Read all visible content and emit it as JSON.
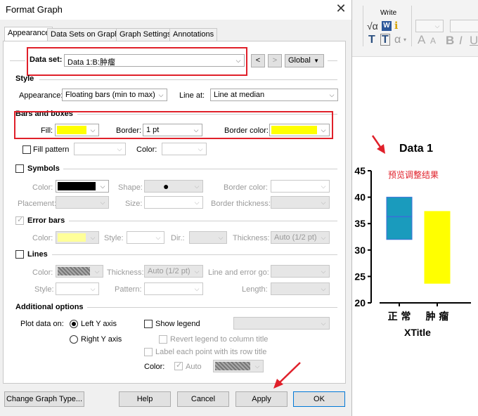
{
  "dialog": {
    "title": "Format Graph",
    "close_glyph": "✕",
    "tabs": [
      "Appearance",
      "Data Sets on Graph",
      "Graph Settings",
      "Annotations"
    ],
    "data_set": {
      "label": "Data set:",
      "value": "Data 1:B:肿瘤",
      "prev": "<",
      "next": ">",
      "scope": "Global"
    },
    "style": {
      "heading": "Style",
      "appearance_label": "Appearance:",
      "appearance_value": "Floating bars (min to max)",
      "line_at_label": "Line at:",
      "line_at_value": "Line at median"
    },
    "bars": {
      "heading": "Bars and boxes",
      "fill_label": "Fill:",
      "fill_color": "#ffff00",
      "border_label": "Border:",
      "border_value": "1 pt",
      "border_color_label": "Border color:",
      "border_color": "#ffff00",
      "fill_pattern_label": "Fill pattern",
      "color_label": "Color:"
    },
    "symbols": {
      "heading": "Symbols",
      "color_label": "Color:",
      "color_value": "#000000",
      "shape_label": "Shape:",
      "shape_glyph": "●",
      "border_color_label": "Border color:",
      "placement_label": "Placement:",
      "size_label": "Size:",
      "border_thickness_label": "Border thickness:"
    },
    "error_bars": {
      "heading": "Error bars",
      "color_label": "Color:",
      "color_value": "#ffff99",
      "style_label": "Style:",
      "dir_label": "Dir.:",
      "thickness_label": "Thickness:",
      "thickness_value": "Auto (1/2 pt)"
    },
    "lines": {
      "heading": "Lines",
      "color_label": "Color:",
      "thickness_label": "Thickness:",
      "thickness_value": "Auto (1/2 pt)",
      "line_error_label": "Line and error go:",
      "style_label": "Style:",
      "pattern_label": "Pattern:",
      "length_label": "Length:"
    },
    "additional": {
      "heading": "Additional options",
      "plot_on_label": "Plot data on:",
      "left_axis": "Left Y axis",
      "right_axis": "Right  Y axis",
      "show_legend": "Show legend",
      "revert_legend": "Revert legend to column title",
      "label_each_point": "Label each point with its row title",
      "color_label": "Color:",
      "auto_label": "Auto"
    },
    "buttons": {
      "change_type": "Change Graph Type...",
      "help": "Help",
      "cancel": "Cancel",
      "apply": "Apply",
      "ok": "OK"
    }
  },
  "ribbon": {
    "group_label": "Write",
    "glyph_sqrt": "√α",
    "glyph_w": "W",
    "glyph_info": "ℹ",
    "glyph_t1": "T",
    "glyph_t2": "T",
    "glyph_alpha": "α",
    "glyph_a1": "A",
    "glyph_a2": "A",
    "glyph_b": "B",
    "glyph_i": "I",
    "glyph_u": "U"
  },
  "annotation": {
    "preview_text": "预览调整结果",
    "color": "#e0202a"
  },
  "chart_data": {
    "type": "bar",
    "subtype": "floating bars (min to max)",
    "title": "Data 1",
    "xlabel": "XTitle",
    "ylabel": "",
    "categories": [
      "正 常",
      "肿 瘤"
    ],
    "series": [
      {
        "category": "正 常",
        "min": 32,
        "max": 40,
        "line": 36.3,
        "fill": "#1a9bbd",
        "border": "#3a6fd8"
      },
      {
        "category": "肿 瘤",
        "min": 23.7,
        "max": 37.3,
        "fill": "#ffff00",
        "border": "#ffff00"
      }
    ],
    "ylim": [
      20,
      45
    ],
    "yticks": [
      20,
      25,
      30,
      35,
      40,
      45
    ],
    "grid": false
  }
}
